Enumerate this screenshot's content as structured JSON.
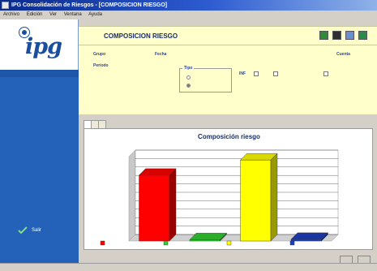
{
  "window": {
    "title": "IPG Consolidación de Riesgos - [COMPOSICION RIESGO]",
    "menu": [
      "Archivo",
      "Edición",
      "Ver",
      "Ventana",
      "Ayuda"
    ]
  },
  "sidebar": {
    "logo_text": "ipg",
    "exit_label": "Salir"
  },
  "header": {
    "title": "COMPOSICION RIESGO",
    "icons": [
      "excel-icon",
      "print-icon",
      "window-icon",
      "close-window-icon"
    ]
  },
  "filters": {
    "grupo_label": "Grupo",
    "grupo_value": "",
    "fecha_label": "Fecha",
    "fecha_value": "",
    "cuenta_label": "Cuenta",
    "cuenta_value": "",
    "periodo_label": "Período",
    "periodo_value": "",
    "fieldset_legend": "Tipo",
    "radio_options": [
      "",
      ""
    ],
    "inf_label": "INF",
    "checkbox_options": [
      "",
      ""
    ]
  },
  "tabs": [
    "",
    "",
    ""
  ],
  "buttons": {
    "primary": "",
    "secondary": ""
  },
  "colors": {
    "titlebar": "#0b2a8c",
    "sidebar": "#2461b9",
    "header_bg": "#ffffcc",
    "series": [
      "#ff0000",
      "#33cc33",
      "#ffff00",
      "#1d3fbf"
    ]
  },
  "chart_data": {
    "type": "bar",
    "title": "Composición riesgo",
    "categories": [
      "",
      "",
      "",
      ""
    ],
    "series": [
      {
        "values": [
          390,
          8,
          480,
          10
        ]
      }
    ],
    "colors": [
      "#ff0000",
      "#33cc33",
      "#ffff00",
      "#1d3fbf"
    ],
    "ylim": [
      0,
      500
    ],
    "yticks": [
      0,
      50,
      100,
      150,
      200,
      250,
      300,
      350,
      400,
      450,
      500
    ],
    "ytick_labels": [
      "",
      "",
      "",
      "",
      "",
      "",
      "",
      "",
      "",
      "",
      ""
    ],
    "grid": true,
    "legend": "bottom"
  }
}
